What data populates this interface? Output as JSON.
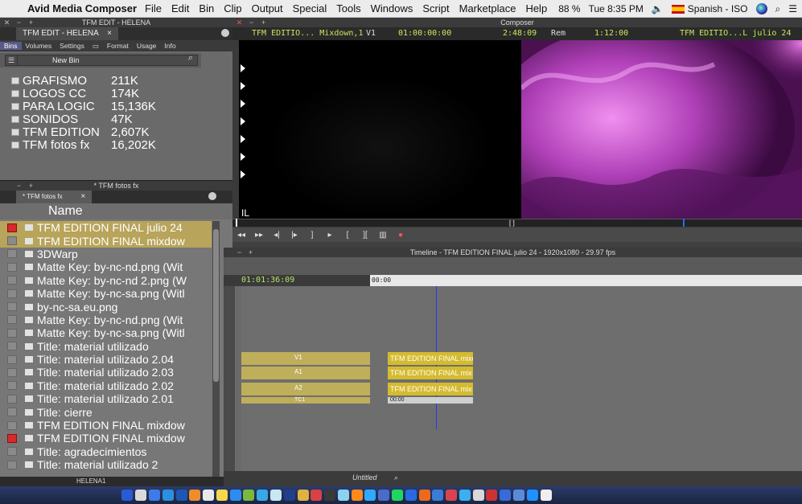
{
  "menubar": {
    "app": "Avid Media Composer",
    "items": [
      "File",
      "Edit",
      "Bin",
      "Clip",
      "Output",
      "Special",
      "Tools",
      "Windows",
      "Script",
      "Marketplace",
      "Help"
    ],
    "battery": "88 %",
    "clock": "Tue 8:35 PM",
    "input_source": "Spanish - ISO"
  },
  "bin_top": {
    "window_title": "TFM EDIT - HELENA",
    "tab": "TFM EDIT - HELENA",
    "tabs": [
      "Bins",
      "Volumes",
      "Settings",
      "Format",
      "Usage",
      "Info"
    ],
    "new_bin": "New Bin",
    "bins": [
      {
        "name": "GRAFISMO",
        "size": "211K"
      },
      {
        "name": "LOGOS CC",
        "size": "174K"
      },
      {
        "name": "PARA LOGIC",
        "size": "15,136K"
      },
      {
        "name": "SONIDOS",
        "size": "47K"
      },
      {
        "name": "TFM EDITION",
        "size": "2,607K"
      },
      {
        "name": "TFM fotos fx",
        "size": "16,202K"
      }
    ]
  },
  "bin_bottom": {
    "window_title": "* TFM fotos fx",
    "tab": "* TFM fotos fx",
    "column": "Name",
    "clips": [
      {
        "name": "TFM EDITION FINAL julio 24",
        "sel": true,
        "red": true
      },
      {
        "name": "TFM EDITION FINAL mixdow",
        "sel": true,
        "red": false
      },
      {
        "name": "3DWarp",
        "sel": false,
        "red": false
      },
      {
        "name": "Matte Key: by-nc-nd.png (Wit",
        "sel": false,
        "red": false
      },
      {
        "name": "Matte Key: by-nc-nd 2.png (W",
        "sel": false,
        "red": false
      },
      {
        "name": "Matte Key: by-nc-sa.png (Witl",
        "sel": false,
        "red": false
      },
      {
        "name": "by-nc-sa.eu.png",
        "sel": false,
        "red": false
      },
      {
        "name": "Matte Key: by-nc-nd.png (Wit",
        "sel": false,
        "red": false
      },
      {
        "name": "Matte Key: by-nc-sa.png (Witl",
        "sel": false,
        "red": false
      },
      {
        "name": "Title: material utilizado",
        "sel": false,
        "red": false
      },
      {
        "name": "Title: material utilizado 2.04",
        "sel": false,
        "red": false
      },
      {
        "name": "Title: material utilizado 2.03",
        "sel": false,
        "red": false
      },
      {
        "name": "Title: material utilizado 2.02",
        "sel": false,
        "red": false
      },
      {
        "name": "Title: material utilizado 2.01",
        "sel": false,
        "red": false
      },
      {
        "name": "Title: cierre",
        "sel": false,
        "red": false
      },
      {
        "name": "TFM EDITION FINAL mixdow",
        "sel": false,
        "red": false
      },
      {
        "name": "TFM EDITION FINAL mixdow",
        "sel": false,
        "red": true
      },
      {
        "name": "Title: agradecimientos",
        "sel": false,
        "red": false
      },
      {
        "name": "Title: material utilizado 2",
        "sel": false,
        "red": false
      }
    ],
    "bottom_label": "HELENA1"
  },
  "composer": {
    "title": "Composer",
    "source_clip": "TFM EDITIO... Mixdown,1",
    "track": "V1",
    "source_tc": "01:00:00:00",
    "duration": "2:48:09",
    "rem_label": "Rem",
    "rem_value": "1:12:00",
    "record_clip": "TFM EDITIO...L julio 24"
  },
  "timeline": {
    "title": "Timeline - TFM EDITION FINAL julio 24 - 1920x1080 - 29.97 fps",
    "timecode": "01:01:36:09",
    "ruler_start": "00:00",
    "tracks": [
      {
        "label": "V1",
        "clip": "TFM EDITION FINAL mixd"
      },
      {
        "label": "A1",
        "clip": "TFM EDITION FINAL mix"
      },
      {
        "label": "A2",
        "clip": "TFM EDITION FINAL mix"
      }
    ],
    "tc1_label": "TC1",
    "tc1_value": "00:00",
    "sequence_name": "Untitled"
  }
}
